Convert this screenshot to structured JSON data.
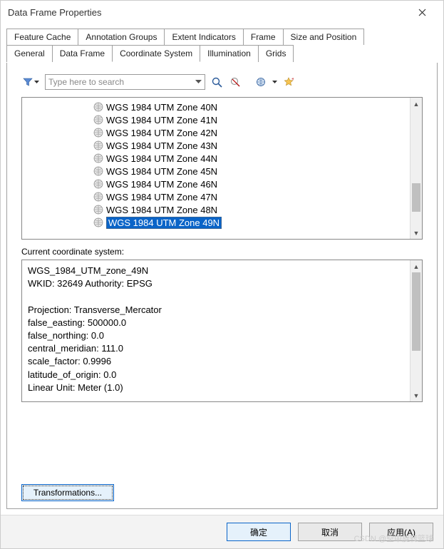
{
  "window": {
    "title": "Data Frame Properties"
  },
  "tabs": {
    "row1": [
      "Feature Cache",
      "Annotation Groups",
      "Extent Indicators",
      "Frame",
      "Size and Position"
    ],
    "row2": [
      "General",
      "Data Frame",
      "Coordinate System",
      "Illumination",
      "Grids"
    ],
    "active": "Coordinate System"
  },
  "search": {
    "placeholder": "Type here to search"
  },
  "tree": {
    "items": [
      "WGS 1984 UTM Zone 40N",
      "WGS 1984 UTM Zone 41N",
      "WGS 1984 UTM Zone 42N",
      "WGS 1984 UTM Zone 43N",
      "WGS 1984 UTM Zone 44N",
      "WGS 1984 UTM Zone 45N",
      "WGS 1984 UTM Zone 46N",
      "WGS 1984 UTM Zone 47N",
      "WGS 1984 UTM Zone 48N",
      "WGS 1984 UTM Zone 49N"
    ],
    "selectedIndex": 9
  },
  "current": {
    "label": "Current coordinate system:",
    "text": "WGS_1984_UTM_zone_49N\nWKID: 32649 Authority: EPSG\n\nProjection: Transverse_Mercator\nfalse_easting: 500000.0\nfalse_northing: 0.0\ncentral_meridian: 111.0\nscale_factor: 0.9996\nlatitude_of_origin: 0.0\nLinear Unit: Meter (1.0)"
  },
  "buttons": {
    "transform": "Transformations...",
    "ok": "确定",
    "cancel": "取消",
    "apply": "应用(A)"
  },
  "watermark": "CSDN @空中旋转篮球"
}
